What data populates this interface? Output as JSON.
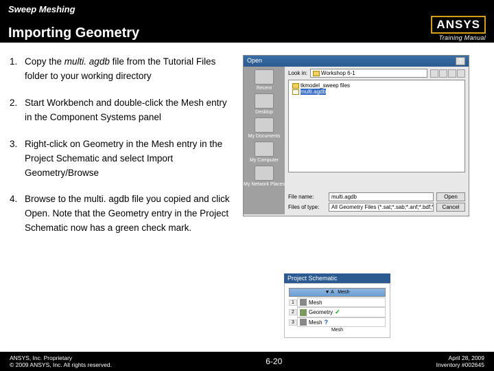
{
  "header": {
    "breadcrumb": "Sweep Meshing",
    "title": "Importing Geometry",
    "logo_text": "ANSYS",
    "logo_sub": "Training Manual"
  },
  "steps": [
    {
      "pre": "Copy the ",
      "em": "multi. agdb",
      "post": " file from the Tutorial Files folder to your working directory"
    },
    {
      "pre": "Start Workbench and double-click the Mesh entry in the Component Systems panel",
      "em": "",
      "post": ""
    },
    {
      "pre": "Right-click on Geometry in the Mesh entry in the Project Schematic and select Import Geometry/Browse",
      "em": "",
      "post": ""
    },
    {
      "pre": "Browse to the multi. agdb file you copied and click Open. Note that the Geometry entry in the Project Schematic now has a green check mark.",
      "em": "",
      "post": ""
    }
  ],
  "dialog": {
    "title": "Open",
    "lookin_label": "Look in:",
    "lookin_value": "Workshop 6-1",
    "sidebar": [
      "Recent",
      "Desktop",
      "My Documents",
      "My Computer",
      "My Network Places"
    ],
    "files": [
      "tkmodel_sweep files",
      "multi.agdb"
    ],
    "filename_label": "File name:",
    "filename_value": "multi.agdb",
    "filetype_label": "Files of type:",
    "filetype_value": "All Geometry Files (*.sat;*.sab;*.anf;*.bdf;*.cmdb;*.dxf;*.x_t;*.x_b)",
    "open_btn": "Open",
    "cancel_btn": "Cancel"
  },
  "schematic": {
    "panel_title": "Project Schematic",
    "header": "Mesh",
    "rows": [
      {
        "n": "1",
        "label": "Mesh",
        "status": ""
      },
      {
        "n": "2",
        "label": "Geometry",
        "status": "chk"
      },
      {
        "n": "3",
        "label": "Mesh",
        "status": "q"
      }
    ],
    "footer": "Mesh"
  },
  "footer": {
    "left1": "ANSYS, Inc. Proprietary",
    "left2": "© 2009 ANSYS, Inc. All rights reserved.",
    "center": "6-20",
    "right1": "April 28, 2009",
    "right2": "Inventory #002645"
  }
}
